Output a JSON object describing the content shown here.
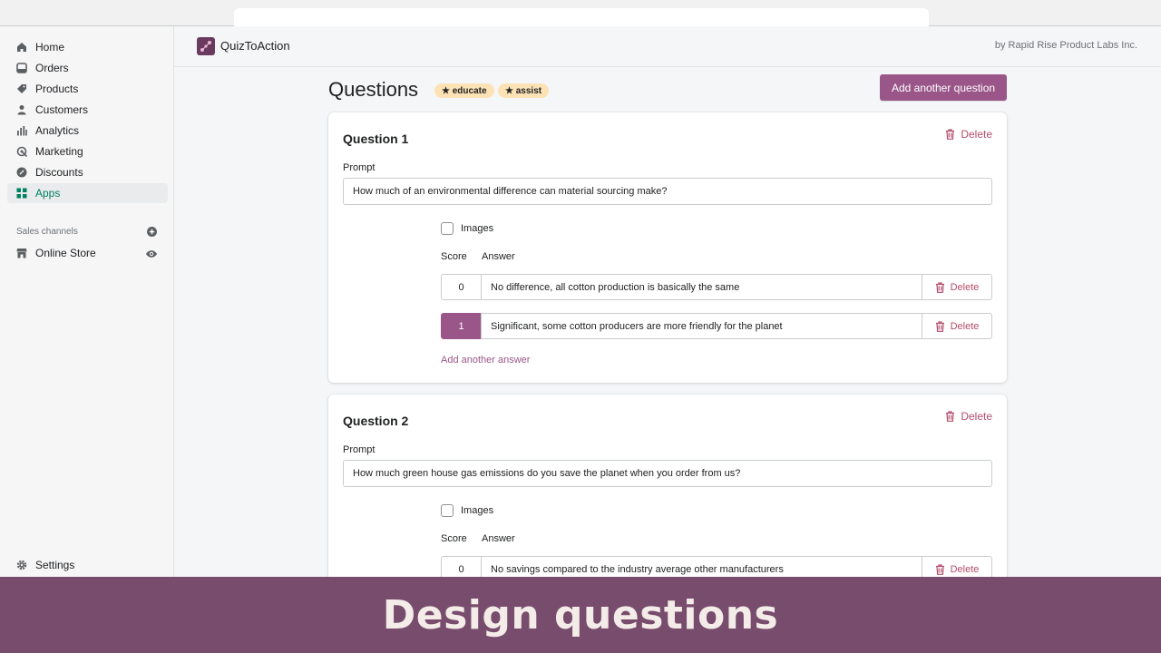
{
  "nav": {
    "items": [
      {
        "label": "Home",
        "icon": "home-icon"
      },
      {
        "label": "Orders",
        "icon": "orders-icon"
      },
      {
        "label": "Products",
        "icon": "tag-icon"
      },
      {
        "label": "Customers",
        "icon": "person-icon"
      },
      {
        "label": "Analytics",
        "icon": "bar-chart-icon"
      },
      {
        "label": "Marketing",
        "icon": "target-icon"
      },
      {
        "label": "Discounts",
        "icon": "discount-icon"
      },
      {
        "label": "Apps",
        "icon": "apps-grid-icon"
      }
    ],
    "active": "Apps",
    "sales_channels_label": "Sales channels",
    "online_store_label": "Online Store",
    "settings_label": "Settings"
  },
  "app": {
    "name": "QuizToAction",
    "by": "by Rapid Rise Product Labs Inc."
  },
  "page": {
    "title": "Questions",
    "badges": [
      "★ educate",
      "★ assist"
    ],
    "add_question_label": "Add another question"
  },
  "questions": [
    {
      "title": "Question 1",
      "delete_label": "Delete",
      "prompt_label": "Prompt",
      "prompt": "How much of an environmental difference can material sourcing make?",
      "images_label": "Images",
      "score_header": "Score",
      "answer_header": "Answer",
      "answers": [
        {
          "score": "0",
          "text": "No difference, all cotton production is basically the same",
          "delete_label": "Delete",
          "selected": false
        },
        {
          "score": "1",
          "text": "Significant, some cotton producers are more friendly for the planet",
          "delete_label": "Delete",
          "selected": true
        }
      ],
      "add_answer_label": "Add another answer"
    },
    {
      "title": "Question 2",
      "delete_label": "Delete",
      "prompt_label": "Prompt",
      "prompt": "How much green house gas emissions do you save the planet when you order from us?",
      "images_label": "Images",
      "score_header": "Score",
      "answer_header": "Answer",
      "answers": [
        {
          "score": "0",
          "text": "No savings compared to the industry average other manufacturers",
          "delete_label": "Delete",
          "selected": false
        }
      ]
    }
  ],
  "banner": "Design questions",
  "colors": {
    "accent": "#9a5688",
    "active_nav": "#008060",
    "delete": "#b34d6b",
    "badge": "#fde2b5",
    "banner": "#784c6c"
  }
}
